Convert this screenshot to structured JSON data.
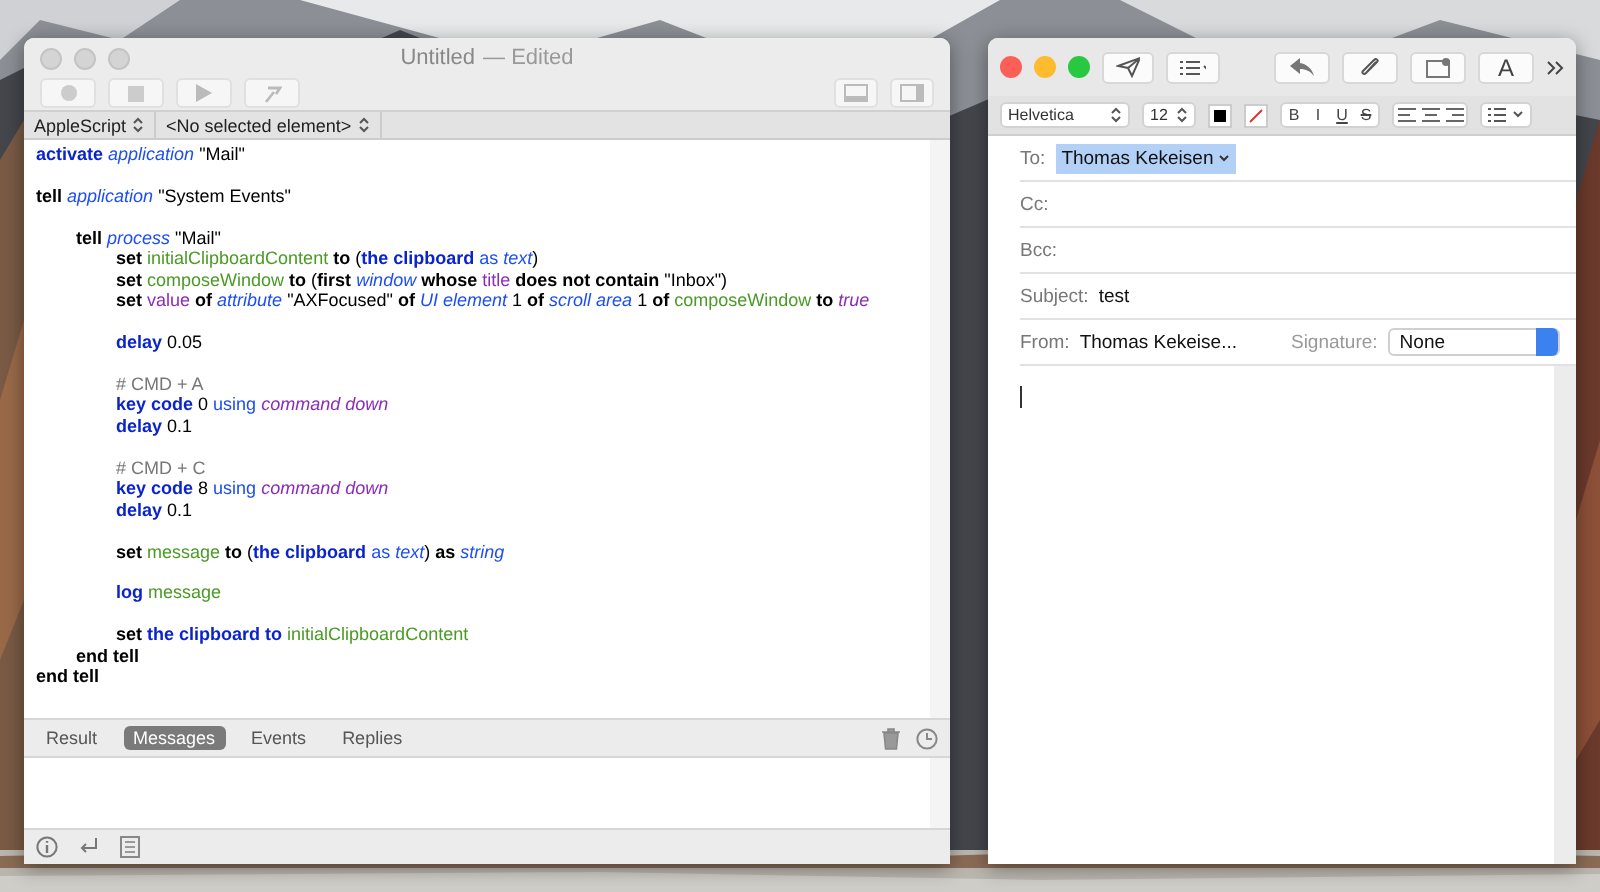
{
  "script_window": {
    "title": "Untitled",
    "status": "— Edited",
    "active": false,
    "language_selector": "AppleScript",
    "element_selector": "<No selected element>",
    "script": {
      "blocks": [
        [
          {
            "tokens": [
              {
                "text": "activate",
                "kind": "command"
              },
              {
                "text": " application",
                "kind": "class"
              },
              {
                "text": " \"Mail\"",
                "kind": "literal"
              }
            ]
          }
        ],
        [
          {
            "tokens": [
              {
                "text": "tell",
                "kind": "operator"
              },
              {
                "text": " application",
                "kind": "class"
              },
              {
                "text": " \"System Events\"",
                "kind": "literal"
              }
            ],
            "spaced": true,
            "end": [
              {
                "text": "end tell",
                "kind": "operator"
              }
            ],
            "blocks": [
              [
                {
                  "tokens": [
                    {
                      "text": "tell",
                      "kind": "operator"
                    },
                    {
                      "text": " process",
                      "kind": "class"
                    },
                    {
                      "text": " \"Mail\"",
                      "kind": "literal"
                    }
                  ],
                  "end": [
                    {
                      "text": "end tell",
                      "kind": "operator"
                    }
                  ],
                  "blocks": [
                    [
                      {
                        "tokens": [
                          {
                            "text": "set",
                            "kind": "operator"
                          },
                          {
                            "text": " initialClipboardContent",
                            "kind": "variable"
                          },
                          {
                            "text": " to",
                            "kind": "operator"
                          },
                          {
                            "text": " (",
                            "kind": "literal"
                          },
                          {
                            "text": "the clipboard",
                            "kind": "command"
                          },
                          {
                            "text": " as",
                            "kind": "param"
                          },
                          {
                            "text": " text",
                            "kind": "class"
                          },
                          {
                            "text": ")",
                            "kind": "literal"
                          }
                        ]
                      },
                      {
                        "tokens": [
                          {
                            "text": "set",
                            "kind": "operator"
                          },
                          {
                            "text": " composeWindow",
                            "kind": "variable"
                          },
                          {
                            "text": " to",
                            "kind": "operator"
                          },
                          {
                            "text": " (",
                            "kind": "literal"
                          },
                          {
                            "text": "first",
                            "kind": "operator"
                          },
                          {
                            "text": " window",
                            "kind": "class"
                          },
                          {
                            "text": " whose",
                            "kind": "operator"
                          },
                          {
                            "text": " title",
                            "kind": "property"
                          },
                          {
                            "text": " does not contain",
                            "kind": "operator"
                          },
                          {
                            "text": " \"Inbox\")",
                            "kind": "literal"
                          }
                        ]
                      },
                      {
                        "tokens": [
                          {
                            "text": "set",
                            "kind": "operator"
                          },
                          {
                            "text": " value",
                            "kind": "property"
                          },
                          {
                            "text": " of",
                            "kind": "operator"
                          },
                          {
                            "text": " attribute",
                            "kind": "class"
                          },
                          {
                            "text": " \"AXFocused\"",
                            "kind": "literal"
                          },
                          {
                            "text": " of",
                            "kind": "operator"
                          },
                          {
                            "text": " UI element",
                            "kind": "class"
                          },
                          {
                            "text": " 1",
                            "kind": "literal"
                          },
                          {
                            "text": " of",
                            "kind": "operator"
                          },
                          {
                            "text": " scroll area",
                            "kind": "class"
                          },
                          {
                            "text": " 1",
                            "kind": "literal"
                          },
                          {
                            "text": " of",
                            "kind": "operator"
                          },
                          {
                            "text": " composeWindow",
                            "kind": "variable"
                          },
                          {
                            "text": " to",
                            "kind": "operator"
                          },
                          {
                            "text": " true",
                            "kind": "enum"
                          }
                        ]
                      }
                    ],
                    [
                      {
                        "tokens": [
                          {
                            "text": "delay",
                            "kind": "command"
                          },
                          {
                            "text": " 0.05",
                            "kind": "literal"
                          }
                        ]
                      }
                    ],
                    [
                      {
                        "tokens": [
                          {
                            "text": "# CMD + A",
                            "kind": "comment"
                          }
                        ]
                      },
                      {
                        "tokens": [
                          {
                            "text": "key code",
                            "kind": "command"
                          },
                          {
                            "text": " 0",
                            "kind": "literal"
                          },
                          {
                            "text": " using",
                            "kind": "param"
                          },
                          {
                            "text": " command down",
                            "kind": "enum"
                          }
                        ]
                      },
                      {
                        "tokens": [
                          {
                            "text": "delay",
                            "kind": "command"
                          },
                          {
                            "text": " 0.1",
                            "kind": "literal"
                          }
                        ]
                      }
                    ],
                    [
                      {
                        "tokens": [
                          {
                            "text": "# CMD + C",
                            "kind": "comment"
                          }
                        ]
                      },
                      {
                        "tokens": [
                          {
                            "text": "key code",
                            "kind": "command"
                          },
                          {
                            "text": " 8",
                            "kind": "literal"
                          },
                          {
                            "text": " using",
                            "kind": "param"
                          },
                          {
                            "text": " command down",
                            "kind": "enum"
                          }
                        ]
                      },
                      {
                        "tokens": [
                          {
                            "text": "delay",
                            "kind": "command"
                          },
                          {
                            "text": " 0.1",
                            "kind": "literal"
                          }
                        ]
                      }
                    ],
                    [
                      {
                        "tokens": [
                          {
                            "text": "set",
                            "kind": "operator"
                          },
                          {
                            "text": " message",
                            "kind": "variable"
                          },
                          {
                            "text": " to",
                            "kind": "operator"
                          },
                          {
                            "text": " (",
                            "kind": "literal"
                          },
                          {
                            "text": "the clipboard",
                            "kind": "command"
                          },
                          {
                            "text": " as",
                            "kind": "param"
                          },
                          {
                            "text": " text",
                            "kind": "class"
                          },
                          {
                            "text": ")",
                            "kind": "literal"
                          },
                          {
                            "text": " as",
                            "kind": "operator"
                          },
                          {
                            "text": " string",
                            "kind": "class"
                          }
                        ]
                      }
                    ],
                    [
                      {
                        "tokens": [
                          {
                            "text": "log",
                            "kind": "command"
                          },
                          {
                            "text": " message",
                            "kind": "variable"
                          }
                        ]
                      }
                    ],
                    [
                      {
                        "tokens": [
                          {
                            "text": "set",
                            "kind": "operator"
                          },
                          {
                            "text": " the clipboard to",
                            "kind": "command"
                          },
                          {
                            "text": " initialClipboardContent",
                            "kind": "variable"
                          }
                        ]
                      }
                    ]
                  ]
                }
              ]
            ]
          }
        ]
      ]
    },
    "tabs": [
      {
        "label": "Result",
        "selected": false
      },
      {
        "label": "Messages",
        "selected": true
      },
      {
        "label": "Events",
        "selected": false
      },
      {
        "label": "Replies",
        "selected": false
      }
    ]
  },
  "mail_window": {
    "active": true,
    "font_button": "A",
    "font_family": "Helvetica",
    "font_size": "12",
    "style_buttons": [
      {
        "label": "B",
        "kind": "bold"
      },
      {
        "label": "I",
        "kind": "italic"
      },
      {
        "label": "U",
        "kind": "underline"
      },
      {
        "label": "S",
        "kind": "strike"
      }
    ],
    "fields": [
      {
        "label": "To:",
        "kind": "recipient",
        "value": "Thomas Kekeisen"
      },
      {
        "label": "Cc:",
        "kind": "text"
      },
      {
        "label": "Bcc:",
        "kind": "text"
      },
      {
        "label": "Subject:",
        "kind": "text",
        "value": "test"
      },
      {
        "label": "From:",
        "kind": "from",
        "value": "Thomas Kekeise...",
        "signature_label": "Signature:",
        "signature": "None"
      }
    ]
  }
}
